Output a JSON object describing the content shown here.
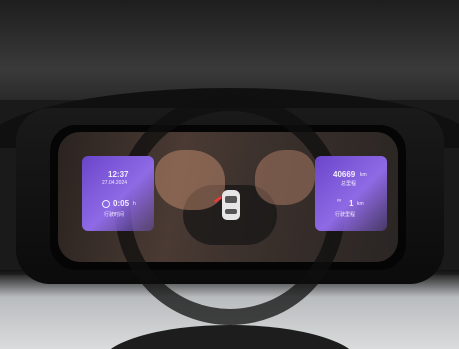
{
  "cluster": {
    "time": "12:37",
    "date": "27.04.2024",
    "drive_time": "0:05",
    "drive_time_unit": "h",
    "drive_time_label": "行驶时间",
    "odometer": "40669",
    "odometer_unit": "km",
    "odometer_label": "总里程",
    "trip_distance": "1",
    "trip_distance_unit": "km",
    "trip_label": "行驶里程"
  },
  "colors": {
    "tile_purple": "#8f6ae6",
    "door_warning": "#e23b3b"
  },
  "icons": [
    "clock-icon",
    "trip-icon",
    "car-door-open-icon"
  ]
}
